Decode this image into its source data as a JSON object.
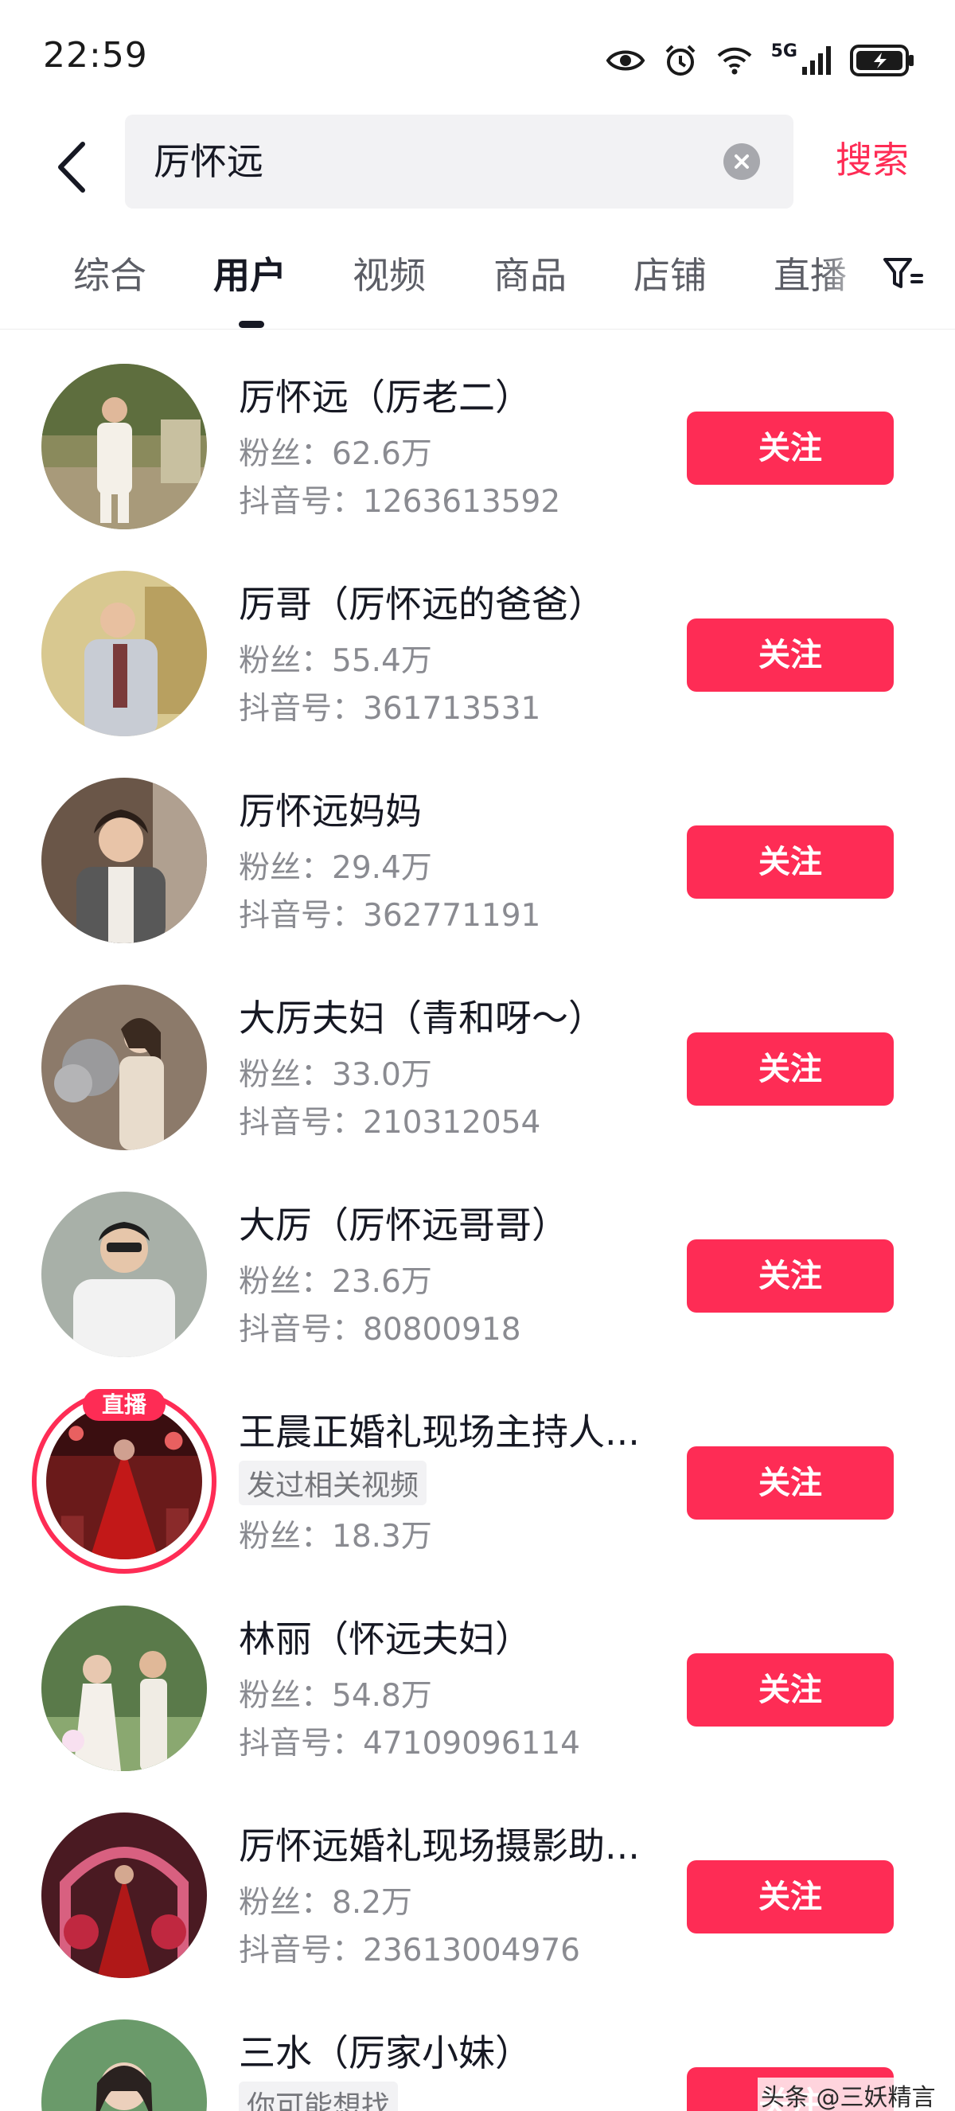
{
  "status_bar": {
    "time": "22:59",
    "network_label": "5G",
    "icons": [
      "eye-icon",
      "alarm-icon",
      "wifi-icon",
      "signal-icon",
      "battery-charging-icon"
    ]
  },
  "search": {
    "query": "厉怀远",
    "submit_label": "搜索"
  },
  "tabs": [
    {
      "label": "综合",
      "active": false
    },
    {
      "label": "用户",
      "active": true
    },
    {
      "label": "视频",
      "active": false
    },
    {
      "label": "商品",
      "active": false
    },
    {
      "label": "店铺",
      "active": false
    },
    {
      "label": "直播",
      "active": false
    }
  ],
  "users": [
    {
      "name": "厉怀远（厉老二）",
      "line1": "粉丝：62.6万",
      "line2": "抖音号：1263613592",
      "follow_label": "关注"
    },
    {
      "name": "厉哥（厉怀远的爸爸）",
      "line1": "粉丝：55.4万",
      "line2": "抖音号：361713531",
      "follow_label": "关注"
    },
    {
      "name": "厉怀远妈妈",
      "line1": "粉丝：29.4万",
      "line2": "抖音号：362771191",
      "follow_label": "关注"
    },
    {
      "name": "大厉夫妇（青和呀～）",
      "line1": "粉丝：33.0万",
      "line2": "抖音号：210312054",
      "follow_label": "关注"
    },
    {
      "name": "大厉（厉怀远哥哥）",
      "line1": "粉丝：23.6万",
      "line2": "抖音号：80800918",
      "follow_label": "关注"
    },
    {
      "name": "王晨正婚礼现场主持人...",
      "live_badge": "直播",
      "tag": "发过相关视频",
      "line2": "粉丝：18.3万",
      "follow_label": "关注"
    },
    {
      "name": "林丽（怀远夫妇）",
      "line1": "粉丝：54.8万",
      "line2": "抖音号：47109096114",
      "follow_label": "关注"
    },
    {
      "name": "厉怀远婚礼现场摄影助...",
      "line1": "粉丝：8.2万",
      "line2": "抖音号：23613004976",
      "follow_label": "关注"
    },
    {
      "name": "三水（厉家小妹）",
      "tag": "你可能想找",
      "follow_label": "关注"
    }
  ],
  "watermark": "头条 @三妖精言",
  "colors": {
    "accent": "#fe2c55",
    "text_primary": "#161823",
    "text_secondary": "#8a8b91"
  }
}
